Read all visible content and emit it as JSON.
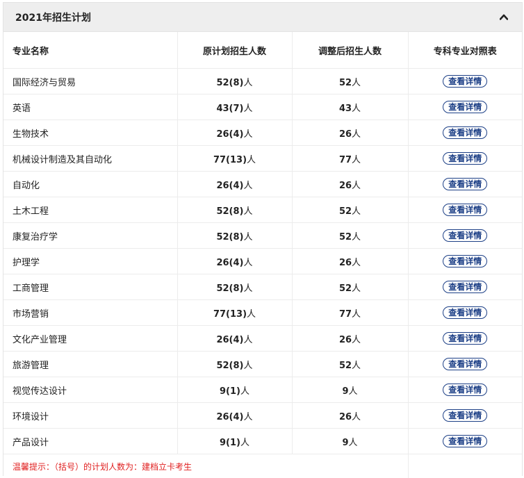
{
  "panel": {
    "title": "2021年招生计划"
  },
  "table": {
    "headers": [
      "专业名称",
      "原计划招生人数",
      "调整后招生人数",
      "专科专业对照表"
    ],
    "button_label": "查看详情",
    "unit": "人",
    "rows": [
      {
        "name": "国际经济与贸易",
        "original": "52(8)",
        "adjusted": "52"
      },
      {
        "name": "英语",
        "original": "43(7)",
        "adjusted": "43"
      },
      {
        "name": "生物技术",
        "original": "26(4)",
        "adjusted": "26"
      },
      {
        "name": "机械设计制造及其自动化",
        "original": "77(13)",
        "adjusted": "77"
      },
      {
        "name": "自动化",
        "original": "26(4)",
        "adjusted": "26"
      },
      {
        "name": "土木工程",
        "original": "52(8)",
        "adjusted": "52"
      },
      {
        "name": "康复治疗学",
        "original": "52(8)",
        "adjusted": "52"
      },
      {
        "name": "护理学",
        "original": "26(4)",
        "adjusted": "26"
      },
      {
        "name": "工商管理",
        "original": "52(8)",
        "adjusted": "52"
      },
      {
        "name": "市场营销",
        "original": "77(13)",
        "adjusted": "77"
      },
      {
        "name": "文化产业管理",
        "original": "26(4)",
        "adjusted": "26"
      },
      {
        "name": "旅游管理",
        "original": "52(8)",
        "adjusted": "52"
      },
      {
        "name": "视觉传达设计",
        "original": "9(1)",
        "adjusted": "9"
      },
      {
        "name": "环境设计",
        "original": "26(4)",
        "adjusted": "26"
      },
      {
        "name": "产品设计",
        "original": "9(1)",
        "adjusted": "9"
      }
    ]
  },
  "note": "温馨提示：（括号）的计划人数为：建档立卡考生",
  "colors": {
    "accent": "#1c3f86",
    "note": "#e02020",
    "header_bg": "#eeeeee"
  },
  "icons": {
    "collapse": "chevron-up-icon"
  }
}
